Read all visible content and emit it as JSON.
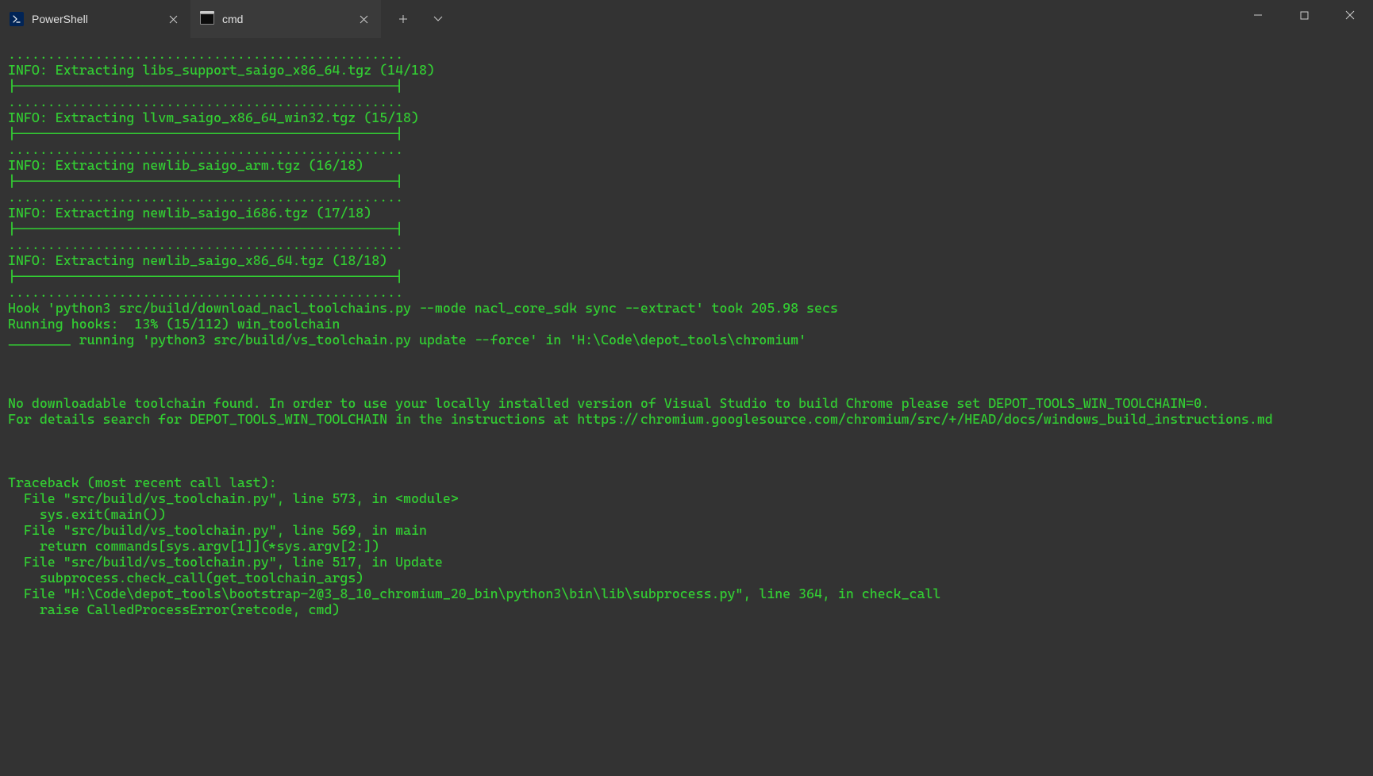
{
  "tabs": [
    {
      "label": "PowerShell",
      "active": false
    },
    {
      "label": "cmd",
      "active": true
    }
  ],
  "terminal_lines": [
    "..................................................",
    "INFO: Extracting libs_support_saigo_x86_64.tgz (14/18)",
    "|------------------------------------------------|",
    "..................................................",
    "INFO: Extracting llvm_saigo_x86_64_win32.tgz (15/18)",
    "|------------------------------------------------|",
    "..................................................",
    "INFO: Extracting newlib_saigo_arm.tgz (16/18)",
    "|------------------------------------------------|",
    "..................................................",
    "INFO: Extracting newlib_saigo_i686.tgz (17/18)",
    "|------------------------------------------------|",
    "..................................................",
    "INFO: Extracting newlib_saigo_x86_64.tgz (18/18)",
    "|------------------------------------------------|",
    "..................................................",
    "Hook 'python3 src/build/download_nacl_toolchains.py --mode nacl_core_sdk sync --extract' took 205.98 secs",
    "Running hooks:  13% (15/112) win_toolchain",
    "________ running 'python3 src/build/vs_toolchain.py update --force' in 'H:\\Code\\depot_tools\\chromium'",
    "",
    "",
    "",
    "No downloadable toolchain found. In order to use your locally installed version of Visual Studio to build Chrome please set DEPOT_TOOLS_WIN_TOOLCHAIN=0.",
    "For details search for DEPOT_TOOLS_WIN_TOOLCHAIN in the instructions at https://chromium.googlesource.com/chromium/src/+/HEAD/docs/windows_build_instructions.md",
    "",
    "",
    "",
    "Traceback (most recent call last):",
    "  File \"src/build/vs_toolchain.py\", line 573, in <module>",
    "    sys.exit(main())",
    "  File \"src/build/vs_toolchain.py\", line 569, in main",
    "    return commands[sys.argv[1]](*sys.argv[2:])",
    "  File \"src/build/vs_toolchain.py\", line 517, in Update",
    "    subprocess.check_call(get_toolchain_args)",
    "  File \"H:\\Code\\depot_tools\\bootstrap-2@3_8_10_chromium_20_bin\\python3\\bin\\lib\\subprocess.py\", line 364, in check_call",
    "    raise CalledProcessError(retcode, cmd)"
  ]
}
